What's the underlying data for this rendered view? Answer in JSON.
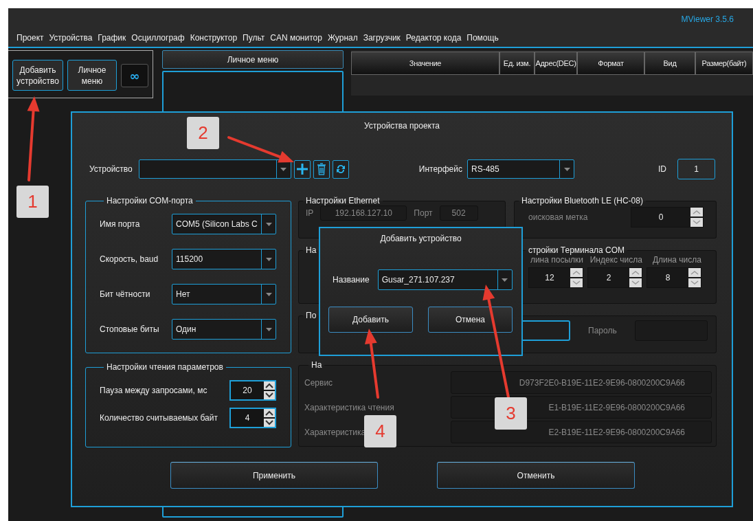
{
  "app": {
    "title": "MViewer 3.5.6"
  },
  "menu": [
    "Проект",
    "Устройства",
    "График",
    "Осциллограф",
    "Конструктор",
    "Пульт",
    "CAN монитор",
    "Журнал",
    "Загрузчик",
    "Редактор кода",
    "Помощь"
  ],
  "left_panel": {
    "buttons": [
      {
        "kind": "text",
        "label": "Добавить устройство"
      },
      {
        "kind": "text",
        "label": "Личное меню"
      },
      {
        "kind": "glyph",
        "label": "∞"
      }
    ]
  },
  "personal_menu": {
    "title": "Личное меню"
  },
  "table": {
    "columns": [
      "Значение",
      "Ед. изм.",
      "Адрес(DEC)",
      "Формат",
      "Вид",
      "Размер(байт)"
    ]
  },
  "project_dialog": {
    "title": "Устройства проекта",
    "device": {
      "label": "Устройство"
    },
    "interface": {
      "label": "Интерфейс",
      "value": "RS-485"
    },
    "id": {
      "label": "ID",
      "value": "1"
    },
    "com_port": {
      "title": "Настройки COM-порта",
      "fields": [
        {
          "label": "Имя порта",
          "value": "COM5 (Silicon Labs C"
        },
        {
          "label": "Скорость, baud",
          "value": "115200"
        },
        {
          "label": "Бит чётности",
          "value": "Нет"
        },
        {
          "label": "Стоповые биты",
          "value": "Один"
        }
      ]
    },
    "reading": {
      "title": "Настройки чтения параметров",
      "fields": [
        {
          "label": "Пауза между запросами, мс",
          "value": "20"
        },
        {
          "label": "Количество считываемых байт",
          "value": "4"
        }
      ]
    },
    "ethernet": {
      "title": "Настройки Ethernet",
      "disabled": true,
      "ip_label": "IP",
      "ip": "192.168.127.10",
      "port_label": "Порт",
      "port": "502"
    },
    "bluetooth_le": {
      "title": "Настройки Bluetooth LE (HC-08)",
      "search_label": "оисковая метка",
      "search_value": "0"
    },
    "group_3": {
      "title": "На"
    },
    "terminal": {
      "title": "стройки Терминала COM",
      "fields": [
        {
          "label": "лина посылки",
          "value": "12"
        },
        {
          "label": "Индекс числа",
          "value": "2"
        },
        {
          "label": "Длина числа",
          "value": "8"
        }
      ]
    },
    "group_4": {
      "title": "По",
      "password_label": "Пароль"
    },
    "group_5": {
      "title": "На",
      "disabled": true,
      "rows": [
        {
          "label": "Сервис",
          "value": "D973F2E0-B19E-11E2-9E96-0800200C9A66"
        },
        {
          "label": "Характеристика чтения",
          "value": "E1-B19E-11E2-9E96-0800200C9A66"
        },
        {
          "label": "Характеристика",
          "value": "E2-B19E-11E2-9E96-0800200C9A66"
        }
      ]
    },
    "buttons": [
      "Применить",
      "Отменить"
    ]
  },
  "add_dialog": {
    "title": "Добавить устройство",
    "name_label": "Название",
    "name_value": "Gusar_271.107.237",
    "buttons": [
      "Добавить",
      "Отмена"
    ]
  },
  "annotations": [
    "1",
    "2",
    "3",
    "4"
  ]
}
